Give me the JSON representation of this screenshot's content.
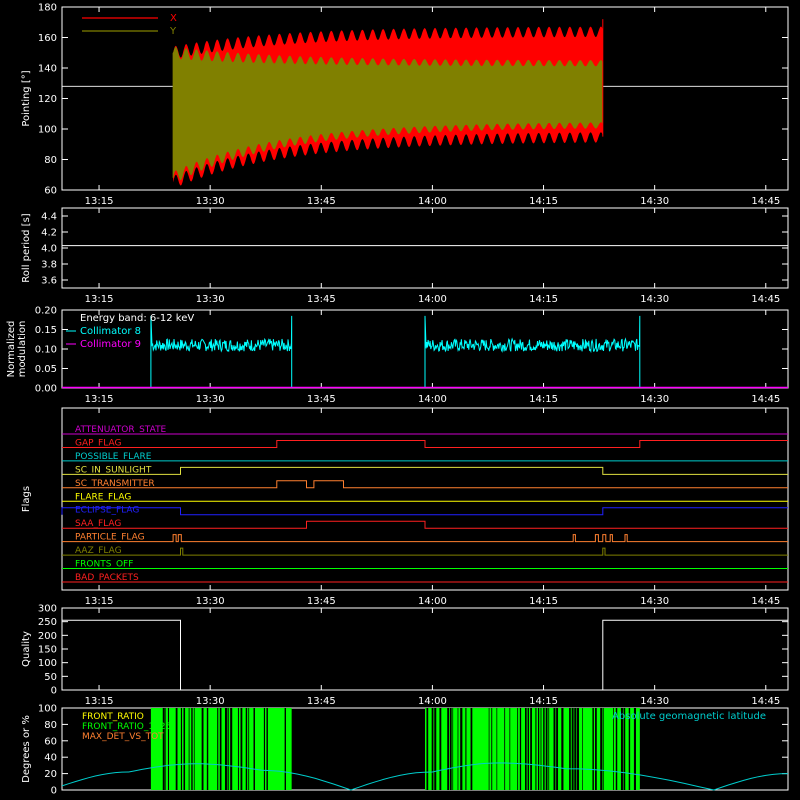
{
  "chart_data": [
    {
      "id": "pointing",
      "type": "line",
      "ylabel": "Pointing [°]",
      "ylim": [
        60,
        180
      ],
      "yticks": [
        60,
        80,
        100,
        120,
        140,
        160,
        180
      ],
      "x_time_ticks": [
        "13:15",
        "13:30",
        "13:45",
        "14:00",
        "14:15",
        "14:30",
        "14:45"
      ],
      "reference_line_y": 128,
      "data_start": "13:25",
      "data_end": "14:23",
      "series": [
        {
          "name": "X",
          "color": "#ff0000",
          "start_range": [
            65,
            150
          ],
          "end_range": [
            95,
            164
          ],
          "oscillation_period_min": 1.4
        },
        {
          "name": "Y",
          "color": "#808000",
          "start_range": [
            68,
            150
          ],
          "end_range": [
            103,
            143
          ],
          "oscillation_period_min": 1.4
        }
      ]
    },
    {
      "id": "roll",
      "type": "line",
      "ylabel": "Roll period [s]",
      "ylim": [
        3.5,
        4.5
      ],
      "yticks": [
        "3.6",
        "3.8",
        "4.0",
        "4.2",
        "4.4"
      ],
      "x_time_ticks": [
        "13:15",
        "13:30",
        "13:45",
        "14:00",
        "14:15",
        "14:30",
        "14:45"
      ],
      "series": [
        {
          "name": "roll period",
          "color": "#ffffff",
          "value": 4.03
        }
      ]
    },
    {
      "id": "modulation",
      "type": "line",
      "ylabel": [
        "Normalized",
        "modulation"
      ],
      "ylim": [
        0,
        0.2
      ],
      "yticks": [
        "0.00",
        "0.05",
        "0.10",
        "0.15",
        "0.20"
      ],
      "x_time_ticks": [
        "13:15",
        "13:30",
        "13:45",
        "14:00",
        "14:15",
        "14:30",
        "14:45"
      ],
      "annotation": "Energy band: 6-12 keV",
      "segments": [
        [
          "13:22",
          "13:41"
        ],
        [
          "13:59",
          "14:28"
        ]
      ],
      "level": 0.11,
      "noise": 0.01,
      "series": [
        {
          "name": "Collimator 8",
          "color": "#00ffff"
        },
        {
          "name": "Collimator 9",
          "color": "#ff00ff",
          "value": 0
        }
      ]
    },
    {
      "id": "flags",
      "type": "line",
      "ylabel": "Flags",
      "x_time_ticks": [
        "13:15",
        "13:30",
        "13:45",
        "14:00",
        "14:15",
        "14:30",
        "14:45"
      ],
      "flags": [
        {
          "name": "ATTENUATOR_STATE",
          "color": "#cc00cc",
          "high": []
        },
        {
          "name": "GAP_FLAG",
          "color": "#ff2020",
          "high": [
            [
              "13:39",
              "13:59"
            ],
            [
              "14:28",
              "14:48"
            ]
          ]
        },
        {
          "name": "POSSIBLE_FLARE",
          "color": "#00cccc",
          "high": []
        },
        {
          "name": "SC_IN_SUNLIGHT",
          "color": "#e0e040",
          "high": [
            [
              "13:26",
              "14:23"
            ]
          ]
        },
        {
          "name": "SC_TRANSMITTER",
          "color": "#ff8030",
          "high": [
            [
              "13:39",
              "13:43"
            ],
            [
              "13:44",
              "13:48"
            ]
          ]
        },
        {
          "name": "FLARE_FLAG",
          "color": "#ffff00",
          "high": []
        },
        {
          "name": "ECLIPSE_FLAG",
          "color": "#2020ff",
          "high": [
            [
              "13:10",
              "13:26"
            ],
            [
              "14:23",
              "14:48"
            ]
          ]
        },
        {
          "name": "SAA_FLAG",
          "color": "#ff2020",
          "high": [
            [
              "13:43",
              "13:59"
            ]
          ]
        },
        {
          "name": "PARTICLE_FLAG",
          "color": "#ff8030",
          "high": [
            [
              "13:25",
              "13:25.4"
            ],
            [
              "13:25.7",
              "13:26.1"
            ],
            [
              "14:19",
              "14:19.3"
            ],
            [
              "14:22",
              "14:22.4"
            ],
            [
              "14:23",
              "14:23.4"
            ],
            [
              "14:24",
              "14:24.3"
            ],
            [
              "14:26",
              "14:26.3"
            ]
          ]
        },
        {
          "name": "AAZ_FLAG",
          "color": "#808000",
          "high": [
            [
              "13:26",
              "13:26.3"
            ],
            [
              "14:23",
              "14:23.3"
            ]
          ]
        },
        {
          "name": "FRONTS_OFF",
          "color": "#00ff00",
          "high": []
        },
        {
          "name": "BAD_PACKETS",
          "color": "#ff2020",
          "high": []
        }
      ]
    },
    {
      "id": "quality",
      "type": "line",
      "ylabel": "Quality",
      "ylim": [
        0,
        300
      ],
      "yticks": [
        0,
        50,
        100,
        150,
        200,
        250,
        300
      ],
      "x_time_ticks": [
        "13:15",
        "13:30",
        "13:45",
        "14:00",
        "14:15",
        "14:30",
        "14:45"
      ],
      "series": [
        {
          "name": "quality",
          "color": "#ffffff",
          "points": [
            [
              "13:10",
              255
            ],
            [
              "13:26",
              255
            ],
            [
              "13:26",
              0
            ],
            [
              "14:23",
              0
            ],
            [
              "14:23",
              255
            ],
            [
              "14:48",
              255
            ]
          ]
        }
      ]
    },
    {
      "id": "ratios",
      "type": "line",
      "ylabel": "Degrees or %",
      "ylim": [
        0,
        100
      ],
      "yticks": [
        0,
        20,
        40,
        60,
        80,
        100
      ],
      "series": [
        {
          "name": "FRONT_RATIO",
          "color": "#ffff00"
        },
        {
          "name": "FRONT_RATIO_1225",
          "color": "#00ff00",
          "segments": [
            [
              "13:22",
              "13:41"
            ],
            [
              "13:59",
              "14:28"
            ]
          ]
        },
        {
          "name": "MAX_DET_VS_TOT",
          "color": "#ff8030"
        },
        {
          "name": "Absolute geomagnetic latitude",
          "color": "#00cccc",
          "points": [
            [
              "13:10",
              5
            ],
            [
              "13:19",
              22
            ],
            [
              "13:28",
              32
            ],
            [
              "13:37",
              24
            ],
            [
              "13:49",
              0
            ],
            [
              "14:00",
              22
            ],
            [
              "14:09",
              33
            ],
            [
              "14:18",
              26
            ],
            [
              "14:38",
              0
            ],
            [
              "14:48",
              20
            ]
          ]
        }
      ]
    }
  ]
}
